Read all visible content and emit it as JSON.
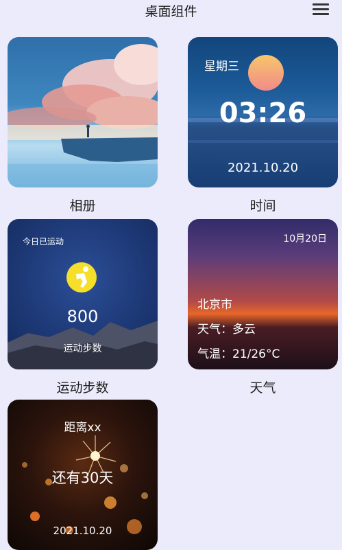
{
  "header": {
    "title": "桌面组件",
    "menu_icon": "menu-icon"
  },
  "widgets": [
    {
      "id": "album",
      "label": "相册"
    },
    {
      "id": "time",
      "label": "时间",
      "weekday": "星期三",
      "time": "03:26",
      "date": "2021.10.20"
    },
    {
      "id": "sport",
      "label": "运动步数",
      "caption": "今日已运动",
      "steps": "800",
      "sublabel": "运动步数",
      "icon": "runner-icon"
    },
    {
      "id": "weather",
      "label": "天气",
      "date": "10月20日",
      "city": "北京市",
      "condition": "天气：多云",
      "temperature": "气温：21/26°C"
    },
    {
      "id": "countdown",
      "title": "距离xx",
      "remaining": "还有30天",
      "date": "2021.10.20"
    }
  ],
  "colors": {
    "background": "#ecebfb",
    "sun_gradient_top": "#f6c66a",
    "sun_gradient_bottom": "#f28a8a",
    "runner_badge": "#f5df2a"
  }
}
